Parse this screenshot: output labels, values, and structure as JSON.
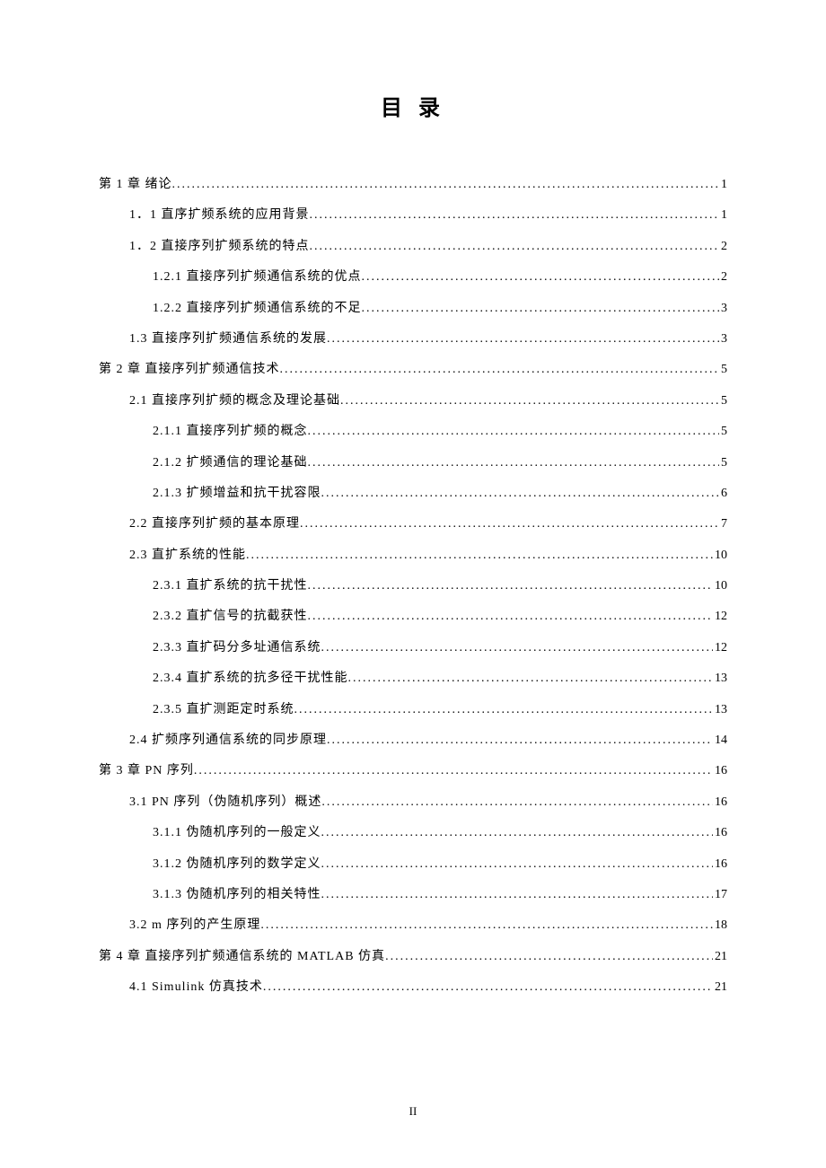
{
  "title": "目 录",
  "footer": "II",
  "toc": [
    {
      "level": 1,
      "text": "第 1 章 绪论",
      "page": "1"
    },
    {
      "level": 2,
      "text": "1．1 直序扩频系统的应用背景",
      "page": "1"
    },
    {
      "level": 2,
      "text": "1．2 直接序列扩频系统的特点",
      "page": "2"
    },
    {
      "level": 3,
      "text": "1.2.1 直接序列扩频通信系统的优点",
      "page": "2"
    },
    {
      "level": 3,
      "text": "1.2.2 直接序列扩频通信系统的不足",
      "page": "3"
    },
    {
      "level": 2,
      "text": "1.3 直接序列扩频通信系统的发展",
      "page": "3"
    },
    {
      "level": 1,
      "text": "第 2 章 直接序列扩频通信技术",
      "page": "5"
    },
    {
      "level": 2,
      "text": "2.1 直接序列扩频的概念及理论基础",
      "page": "5"
    },
    {
      "level": 3,
      "text": "2.1.1 直接序列扩频的概念",
      "page": "5"
    },
    {
      "level": 3,
      "text": "2.1.2 扩频通信的理论基础",
      "page": "5"
    },
    {
      "level": 3,
      "text": "2.1.3 扩频增益和抗干扰容限",
      "page": "6"
    },
    {
      "level": 2,
      "text": "2.2 直接序列扩频的基本原理",
      "page": "7"
    },
    {
      "level": 2,
      "text": "2.3 直扩系统的性能",
      "page": "10"
    },
    {
      "level": 3,
      "text": "2.3.1  直扩系统的抗干扰性",
      "page": "10"
    },
    {
      "level": 3,
      "text": "2.3.2  直扩信号的抗截获性",
      "page": "12"
    },
    {
      "level": 3,
      "text": "2.3.3 直扩码分多址通信系统",
      "page": "12"
    },
    {
      "level": 3,
      "text": "2.3.4  直扩系统的抗多径干扰性能",
      "page": "13"
    },
    {
      "level": 3,
      "text": "2.3.5  直扩测距定时系统",
      "page": "13"
    },
    {
      "level": 2,
      "text": "2.4 扩频序列通信系统的同步原理",
      "page": "14"
    },
    {
      "level": 1,
      "text": "第 3 章 PN 序列",
      "page": "16"
    },
    {
      "level": 2,
      "text": "3.1 PN 序列（伪随机序列）概述",
      "page": "16"
    },
    {
      "level": 3,
      "text": "3.1.1 伪随机序列的一般定义",
      "page": "16"
    },
    {
      "level": 3,
      "text": "3.1.2 伪随机序列的数学定义",
      "page": "16"
    },
    {
      "level": 3,
      "text": "3.1.3 伪随机序列的相关特性",
      "page": "17"
    },
    {
      "level": 2,
      "text": "3.2 m 序列的产生原理",
      "page": "18"
    },
    {
      "level": 1,
      "text": "第 4 章 直接序列扩频通信系统的 MATLAB 仿真",
      "page": "21"
    },
    {
      "level": 2,
      "text": "4.1 Simulink 仿真技术",
      "page": "21"
    }
  ]
}
